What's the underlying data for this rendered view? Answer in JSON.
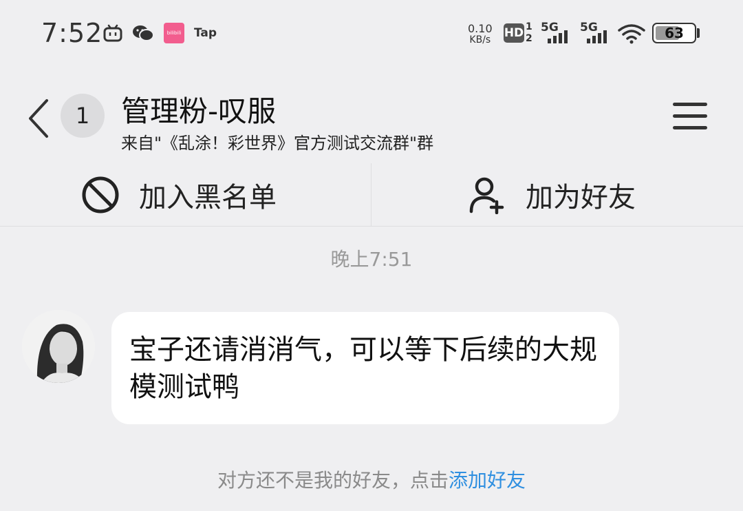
{
  "status_bar": {
    "time": "7:52",
    "app_icons": [
      "bilibili-tv-icon",
      "wechat-icon",
      "bilibili-icon",
      "taptap-icon"
    ],
    "taptap_label": "Tap",
    "bilibili_label": "bilibili",
    "net_speed_value": "0.10",
    "net_speed_unit": "KB/s",
    "hd_label": "HD",
    "hd_sim1": "1",
    "hd_sim2": "2",
    "sim1_label": "5G",
    "sim2_label": "5G",
    "battery_level": "63",
    "battery_fraction": 0.63
  },
  "header": {
    "unread_count": "1",
    "title": "管理粉-叹服",
    "subtitle": "来自\"《乱涂！彩世界》官方测试交流群\"群"
  },
  "actions": {
    "block_label": "加入黑名单",
    "add_friend_label": "加为好友"
  },
  "conversation": {
    "timestamp": "晚上7:51",
    "message_text": "宝子还请消消气，可以等下后续的大规模测试鸭",
    "notice_text": "对方还不是我的好友，点击",
    "notice_link": "添加好友"
  },
  "colors": {
    "background": "#efeff1",
    "bubble": "#ffffff",
    "link": "#2f8fe0",
    "bilibili_pink": "#f25d8e"
  }
}
